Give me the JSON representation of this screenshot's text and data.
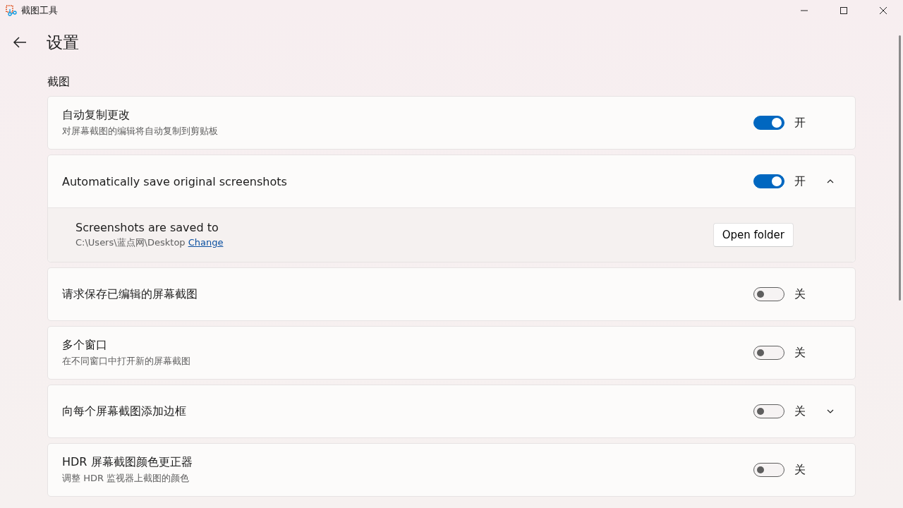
{
  "window": {
    "title": "截图工具"
  },
  "page": {
    "title": "设置"
  },
  "section": {
    "title": "截图"
  },
  "settings": [
    {
      "kind": "toggle",
      "title": "自动复制更改",
      "description": "对屏幕截图的编辑将自动复制到剪贴板",
      "on": true,
      "state_label": "开"
    },
    {
      "kind": "expander",
      "title": "Automatically save original screenshots",
      "on": true,
      "state_label": "开",
      "expanded": true,
      "detail": {
        "title": "Screenshots are saved to",
        "path": "C:\\Users\\蓝点网\\Desktop",
        "link": "Change",
        "button": "Open folder"
      }
    },
    {
      "kind": "toggle",
      "title": "请求保存已编辑的屏幕截图",
      "on": false,
      "state_label": "关"
    },
    {
      "kind": "toggle",
      "title": "多个窗口",
      "description": "在不同窗口中打开新的屏幕截图",
      "on": false,
      "state_label": "关"
    },
    {
      "kind": "expander",
      "title": "向每个屏幕截图添加边框",
      "on": false,
      "state_label": "关",
      "expanded": false
    },
    {
      "kind": "toggle",
      "title": "HDR 屏幕截图颜色更正器",
      "description": "调整 HDR 监视器上截图的颜色",
      "on": false,
      "state_label": "关"
    }
  ]
}
